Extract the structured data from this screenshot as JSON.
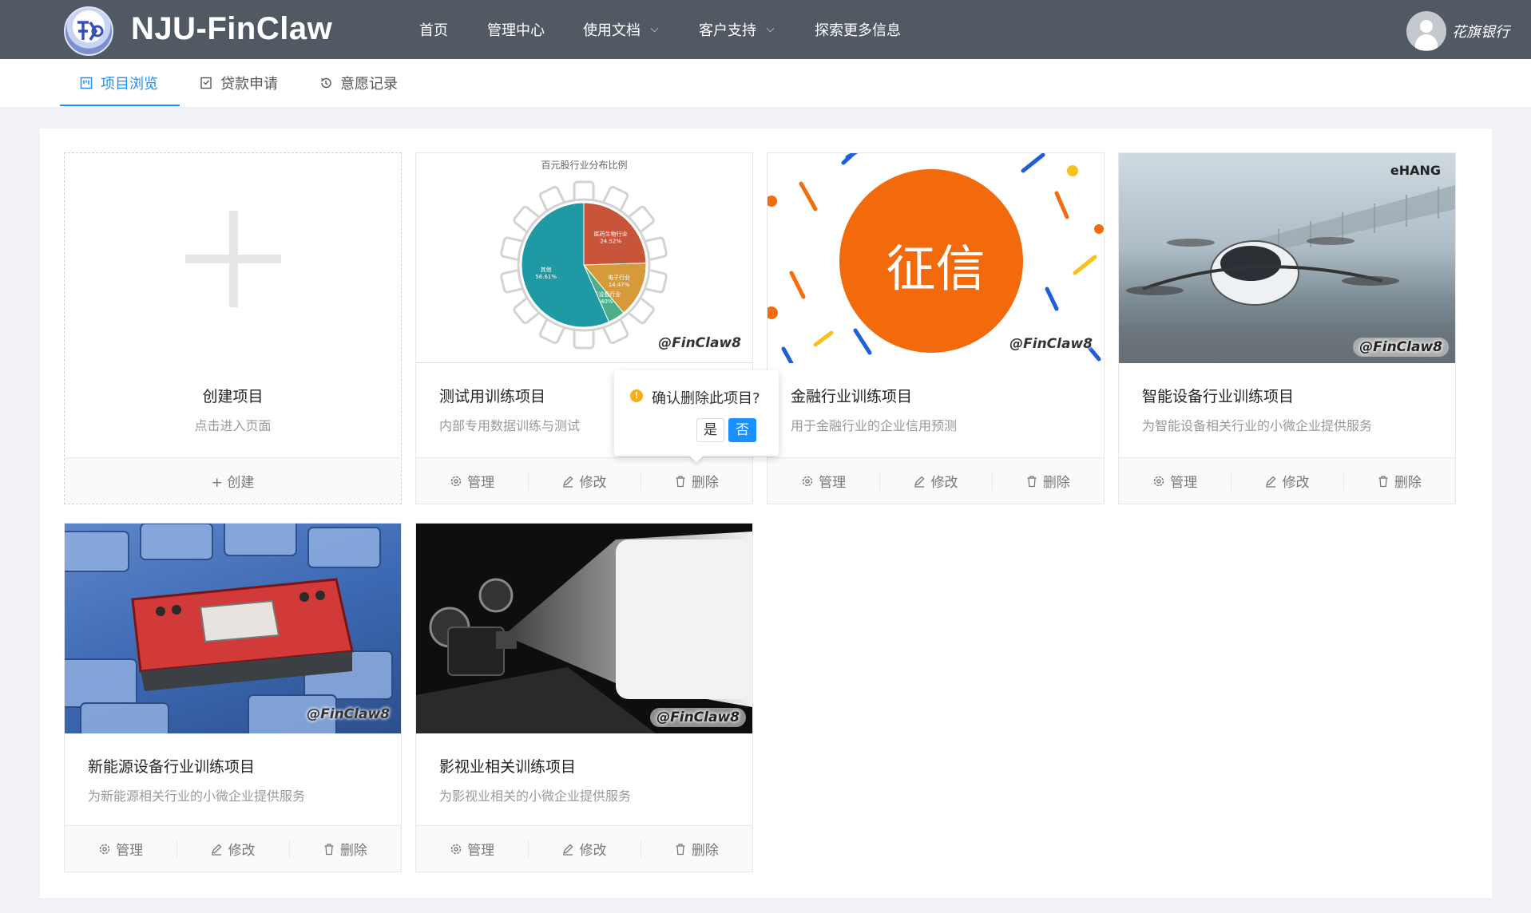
{
  "header": {
    "brand": "NJU-FinClaw",
    "nav": [
      {
        "label": "首页"
      },
      {
        "label": "管理中心"
      },
      {
        "label": "使用文档"
      },
      {
        "label": "客户支持"
      },
      {
        "label": "探索更多信息"
      }
    ],
    "username": "花旗银行"
  },
  "tabs": [
    {
      "label": "项目浏览",
      "icon": "project-icon",
      "active": true
    },
    {
      "label": "贷款申请",
      "icon": "loan-icon",
      "active": false
    },
    {
      "label": "意愿记录",
      "icon": "history-icon",
      "active": false
    }
  ],
  "create_card": {
    "title": "创建项目",
    "desc": "点击进入页面",
    "action": "+ 创建"
  },
  "actions": {
    "manage": "管理",
    "edit": "修改",
    "delete": "删除"
  },
  "watermark": "@FinClaw8",
  "projects": [
    {
      "title": "测试用训练项目",
      "desc": "内部专用数据训练与测试",
      "cover": "pie-chart-cover",
      "cover_title": "百元股行业分布比例",
      "slices": [
        {
          "label": "医药生物行业",
          "pct": "24.52%",
          "value": 24.52,
          "color": "#c8553a"
        },
        {
          "label": "电子行业",
          "pct": "14.47%",
          "value": 14.47,
          "color": "#d79a3a"
        },
        {
          "label": "电子设备行业",
          "pct": "4.40%",
          "value": 4.4,
          "color": "#4caf8a"
        },
        {
          "label": "其他",
          "pct": "56.61%",
          "value": 56.61,
          "color": "#1f9aa5"
        }
      ]
    },
    {
      "title": "金融行业训练项目",
      "desc": "用于金融行业的企业信用预测",
      "cover": "credit-cover",
      "cover_text": "征信"
    },
    {
      "title": "智能设备行业训练项目",
      "desc": "为智能设备相关行业的小微企业提供服务",
      "cover": "drone-cover",
      "cover_brand": "eHANG"
    },
    {
      "title": "新能源设备行业训练项目",
      "desc": "为新能源相关行业的小微企业提供服务",
      "cover": "battery-cover"
    },
    {
      "title": "影视业相关训练项目",
      "desc": "为影视业相关的小微企业提供服务",
      "cover": "projector-cover"
    }
  ],
  "popconfirm": {
    "text": "确认删除此项目?",
    "yes": "是",
    "no": "否"
  },
  "colors": {
    "header_bg": "#515a63",
    "accent": "#1890ff",
    "warn": "#faad14"
  }
}
